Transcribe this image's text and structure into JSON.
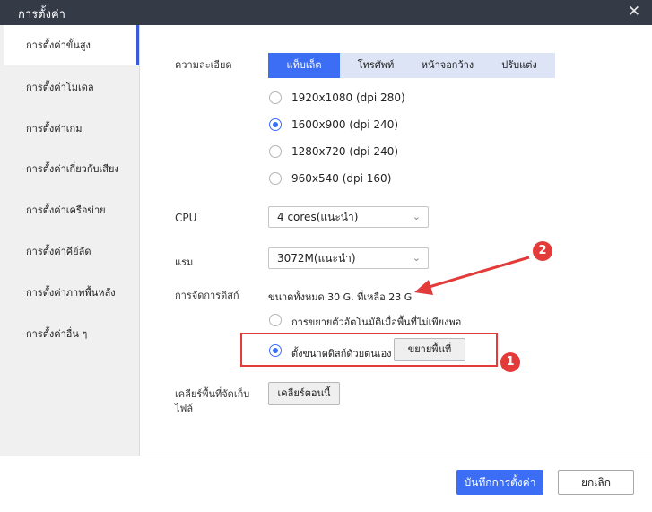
{
  "window": {
    "title": "การตั้งค่า",
    "close_glyph": "✕"
  },
  "sidebar": {
    "items": [
      {
        "label": "การตั้งค่าขั้นสูง"
      },
      {
        "label": "การตั้งค่าโมเดล"
      },
      {
        "label": "การตั้งค่าเกม"
      },
      {
        "label": "การตั้งค่าเกี่ยวกับเสียง"
      },
      {
        "label": "การตั้งค่าเครือข่าย"
      },
      {
        "label": "การตั้งค่าคีย์ลัด"
      },
      {
        "label": "การตั้งค่าภาพพื้นหลัง"
      },
      {
        "label": "การตั้งค่าอื่น ๆ"
      }
    ],
    "active_index": 0
  },
  "resolution": {
    "label": "ความละเอียด",
    "tabs": [
      "แท็บเล็ต",
      "โทรศัพท์",
      "หน้าจอกว้าง",
      "ปรับแต่ง"
    ],
    "active_tab": 0,
    "options": [
      {
        "text": "1920x1080  (dpi 280)",
        "selected": false
      },
      {
        "text": "1600x900  (dpi 240)",
        "selected": true
      },
      {
        "text": "1280x720  (dpi 240)",
        "selected": false
      },
      {
        "text": "960x540  (dpi 160)",
        "selected": false
      }
    ]
  },
  "cpu": {
    "label": "CPU",
    "value": "4 cores(แนะนำ)"
  },
  "ram": {
    "label": "แรม",
    "value": "3072M(แนะนำ)"
  },
  "disk": {
    "label": "การจัดการดิสก์",
    "summary": "ขนาดทั้งหมด 30 G,  ที่เหลือ 23 G",
    "auto_option": "การขยายตัวอัตโนมัติเมื่อพื้นที่ไม่เพียงพอ",
    "manual_option": "ตั้งขนาดดิสก์ด้วยตนเอง",
    "expand_button": "ขยายพื้นที่",
    "selected": "manual"
  },
  "cache": {
    "label_line1": "เคลียร์พื้นที่จัดเก็บ",
    "label_line2": "ไฟล์",
    "button": "เคลียร์ตอนนี้"
  },
  "annotations": {
    "badge1": "1",
    "badge2": "2",
    "color": "#e33a3a"
  },
  "footer": {
    "save": "บันทึกการตั้งค่า",
    "cancel": "ยกเลิก"
  },
  "colors": {
    "accent": "#3b6ef5",
    "titlebar": "#353a47"
  }
}
